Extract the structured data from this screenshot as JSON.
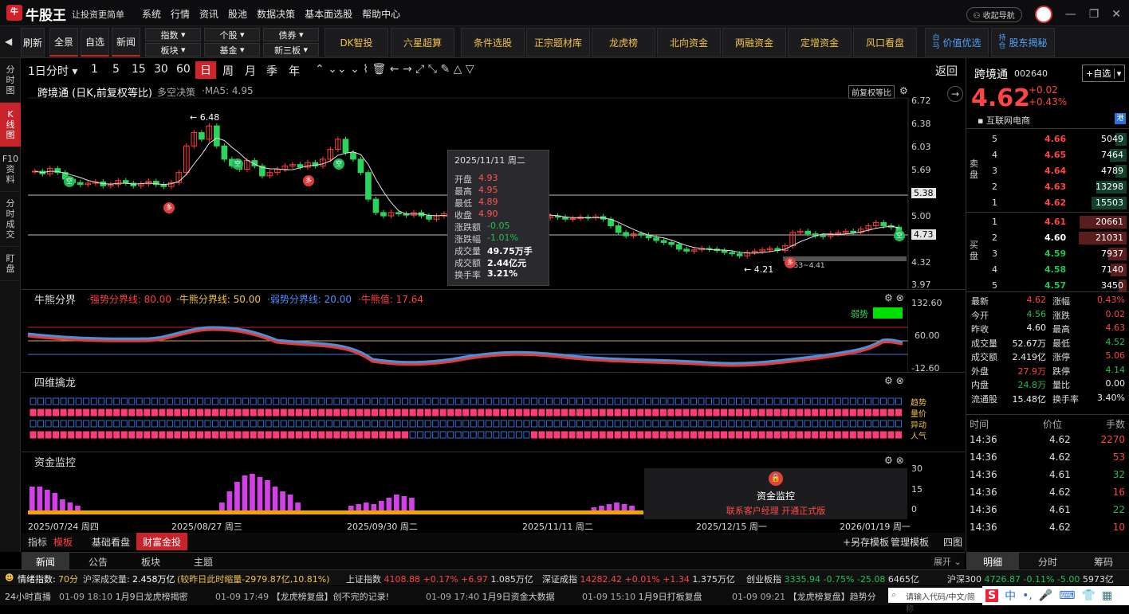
{
  "app": {
    "logo_mark": "牛",
    "name": "牛股王",
    "slogan": "让投资更简单"
  },
  "menu": [
    "系统",
    "行情",
    "资讯",
    "股池",
    "数据决策",
    "基本面选股",
    "帮助中心"
  ],
  "title_right": {
    "nav": "收起导航"
  },
  "toolbar": {
    "refresh": "刷新",
    "all": "全景",
    "fav": "自选",
    "news": "新闻",
    "dropdowns": [
      "指数",
      "个股",
      "债券",
      "板块",
      "基金",
      "新三板"
    ],
    "tools": [
      "DK智投",
      "六星超算",
      "条件选股",
      "正宗题材库",
      "龙虎榜",
      "北向资金",
      "两融资金",
      "定增资金",
      "风口看盘"
    ],
    "value": "价值优选",
    "holder": "股东揭秘",
    "holder_tag1": "持",
    "holder_tag2": "仓",
    "value_tag1": "白",
    "value_tag2": "马"
  },
  "leftnav": [
    [
      "分",
      "时",
      "图"
    ],
    [
      "K",
      "线",
      "图"
    ],
    [
      "F10",
      "资",
      "料"
    ],
    [
      "分",
      "时",
      "成",
      "交"
    ],
    [
      "盯",
      "盘"
    ]
  ],
  "period": {
    "items": [
      "1日分时",
      "1",
      "5",
      "15",
      "30",
      "60",
      "日",
      "周",
      "月",
      "季",
      "年"
    ],
    "back": "返回"
  },
  "main": {
    "title": "跨境通 (日K,前复权等比)",
    "sub": "多空决策",
    "ma": "·MA5: 4.95",
    "adj_btn": "前复权等比",
    "y_labels": [
      "6.72",
      "6.38",
      "6.03",
      "5.69",
      "5.35",
      "5.00",
      "4.66",
      "4.32",
      "3.97"
    ],
    "price_tag1": "5.38",
    "price_tag2": "4.73",
    "high_label": "← 6.48",
    "low_label": "← 4.21",
    "range_label": "4.53~4.41",
    "marker_empty": "空",
    "marker_more": "多"
  },
  "tooltip": {
    "date": "2025/11/11 周二",
    "rows": [
      [
        "开盘",
        "4.93"
      ],
      [
        "最高",
        "4.95"
      ],
      [
        "最低",
        "4.89"
      ],
      [
        "收盘",
        "4.90"
      ],
      [
        "涨跌额",
        "-0.05"
      ],
      [
        "涨跌幅",
        "-1.01%"
      ],
      [
        "成交量",
        "49.75万手"
      ],
      [
        "成交额",
        "2.44亿元"
      ],
      [
        "换手率",
        "3.21%"
      ]
    ]
  },
  "bull": {
    "title": "牛熊分界",
    "strong": "·强势分界线: 80.00",
    "bull": "·牛熊分界线: 50.00",
    "weak": "·弱势分界线: 20.00",
    "val": "·牛熊值: 17.64",
    "y": [
      "132.60",
      "60.00",
      "-12.60"
    ],
    "tag": "弱势"
  },
  "dragon": {
    "title": "四维擒龙",
    "labels": [
      "趋势",
      "量价",
      "异动",
      "人气"
    ]
  },
  "fund": {
    "title": "资金监控",
    "y": [
      "30",
      "15",
      "0"
    ],
    "lock_title": "资金监控",
    "lock_sub": "联系客户经理 开通正式版"
  },
  "dates": [
    "2025/07/24 周四",
    "2025/08/27 周三",
    "2025/09/30 周二",
    "2025/11/11 周二",
    "2025/12/15 周一",
    "2026/01/19 周一"
  ],
  "bottomtabs": {
    "ind": "指标",
    "tmpl": "模板",
    "basic": "基础看盘",
    "wealth": "财富金投",
    "save": "+另存模板",
    "manage": "管理模板",
    "map": "四图"
  },
  "newstabs": [
    "新闻",
    "公告",
    "板块",
    "主题"
  ],
  "expand": "展开",
  "right": {
    "name": "跨境通",
    "code": "002640",
    "fav": "+自选",
    "price": "4.62",
    "chg": "+0.02",
    "pct": "+0.43%",
    "sector": "互联网电商",
    "hk": "港",
    "sell_label": [
      "卖",
      "盘"
    ],
    "buy_label": [
      "买",
      "盘"
    ],
    "sells": [
      [
        "5",
        "4.66",
        "5049"
      ],
      [
        "4",
        "4.65",
        "7464"
      ],
      [
        "3",
        "4.64",
        "4789"
      ],
      [
        "2",
        "4.63",
        "13298"
      ],
      [
        "1",
        "4.62",
        "15503"
      ]
    ],
    "buys": [
      [
        "1",
        "4.61",
        "20661"
      ],
      [
        "2",
        "4.60",
        "21031"
      ],
      [
        "3",
        "4.59",
        "7937"
      ],
      [
        "4",
        "4.58",
        "7140"
      ],
      [
        "5",
        "4.57",
        "3450"
      ]
    ],
    "stats": [
      [
        "最新",
        "4.62",
        "涨幅",
        "0.43%"
      ],
      [
        "今开",
        "4.56",
        "涨跌",
        "0.02"
      ],
      [
        "昨收",
        "4.60",
        "最高",
        "4.63"
      ],
      [
        "成交量",
        "52.67万",
        "最低",
        "4.52"
      ],
      [
        "成交额",
        "2.419亿",
        "涨停",
        "5.06"
      ],
      [
        "外盘",
        "27.9万",
        "跌停",
        "4.14"
      ],
      [
        "内盘",
        "24.8万",
        "量比",
        "0.00"
      ],
      [
        "流通股",
        "15.48亿",
        "换手率",
        "3.40%"
      ]
    ],
    "tick_head": [
      "时间",
      "价位",
      "手数"
    ],
    "ticks": [
      [
        "14:36",
        "4.62",
        "2270"
      ],
      [
        "14:36",
        "4.62",
        "53"
      ],
      [
        "14:36",
        "4.61",
        "32"
      ],
      [
        "14:36",
        "4.62",
        "16"
      ],
      [
        "14:36",
        "4.61",
        "22"
      ],
      [
        "14:36",
        "4.62",
        "10"
      ]
    ],
    "tabs": [
      "明细",
      "分时",
      "筹码"
    ]
  },
  "ticker": {
    "mood_label": "情绪指数:",
    "mood": "70分",
    "vol_label": "沪深成交量:",
    "vol": "2.458万亿",
    "vol_note": "(较昨日此时缩量-2979.87亿,10.81%)",
    "items": [
      [
        "上证指数",
        "4108.88",
        "+0.17%",
        "+6.97",
        "1.085万亿"
      ],
      [
        "深证成指",
        "14282.42",
        "+0.01%",
        "+1.34",
        "1.375万亿"
      ],
      [
        "创业板指",
        "3335.94",
        "-0.75%",
        "-25.08",
        "6465亿"
      ],
      [
        "沪深300",
        "4726.87",
        "-0.11%",
        "-5.00",
        "5973亿"
      ]
    ]
  },
  "news": {
    "live": "24小时直播",
    "items": [
      [
        "01-09 18:10",
        "1月9日龙虎榜揭密"
      ],
      [
        "01-09 17:49",
        "【龙虎榜复盘】创不完的记录!"
      ],
      [
        "01-09 17:40",
        "1月9日资金大数据"
      ],
      [
        "01-09 15:10",
        "1月9日打板复盘"
      ],
      [
        "01-09 09:21",
        "【龙虎榜复盘】趋势分"
      ]
    ],
    "input_placeholder": "请输入代码/中文/简称",
    "ime": "中"
  }
}
